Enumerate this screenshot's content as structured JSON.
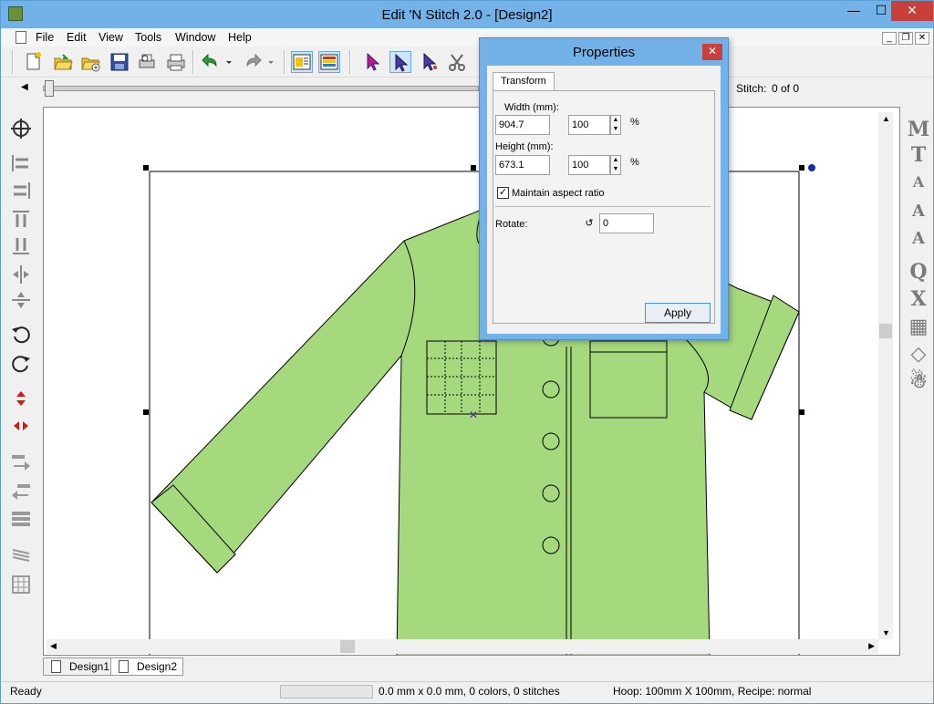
{
  "window": {
    "title": "Edit 'N Stitch 2.0 - [Design2]",
    "minimize": "—",
    "maximize": "☐",
    "close": "✕"
  },
  "menu": {
    "file": "File",
    "edit": "Edit",
    "view": "View",
    "tools": "Tools",
    "window": "Window",
    "help": "Help"
  },
  "mdi_controls": [
    "_",
    "❐",
    "✕"
  ],
  "toolbar": {
    "stitch_label": "Stitch:",
    "stitch_value": "0 of 0"
  },
  "right_tools": [
    "M",
    "T",
    "A",
    "A",
    "A",
    "Q",
    "X",
    "▦",
    "◇",
    "☃"
  ],
  "dialog": {
    "title": "Properties",
    "close": "✕",
    "tab": "Transform",
    "width_label": "Width (mm):",
    "width_value": "904.7",
    "width_percent": "100",
    "height_label": "Height (mm):",
    "height_value": "673.1",
    "height_percent": "100",
    "percent_sign": "%",
    "maintain_aspect": "Maintain aspect ratio",
    "maintain_checked": true,
    "rotate_label": "Rotate:",
    "rotate_value": "0",
    "apply": "Apply"
  },
  "tabs": [
    "Design1",
    "Design2"
  ],
  "status": {
    "ready": "Ready",
    "info": "0.0 mm x 0.0 mm, 0 colors, 0 stitches",
    "hoop": "Hoop: 100mm X 100mm, Recipe: normal"
  },
  "colors": {
    "shirt_fill": "#a6d87e",
    "titlebar": "#73b2e8",
    "close_red": "#c7403a"
  }
}
